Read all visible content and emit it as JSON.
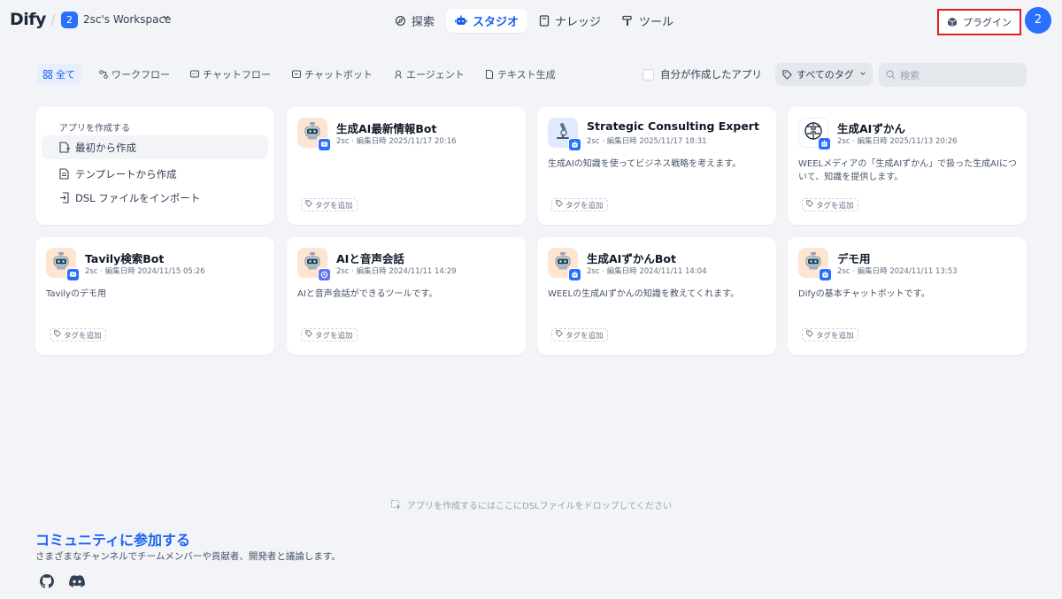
{
  "header": {
    "logo": "Dify",
    "workspace_badge": "2",
    "workspace_name": "2sc's Workspace",
    "nav": [
      {
        "label": "探索",
        "icon": "explore-icon"
      },
      {
        "label": "スタジオ",
        "icon": "robot-icon",
        "active": true
      },
      {
        "label": "ナレッジ",
        "icon": "book-icon"
      },
      {
        "label": "ツール",
        "icon": "hammer-icon"
      }
    ],
    "plugin_label": "プラグイン",
    "avatar_label": "2",
    "highlight_color": "#e11d1d"
  },
  "filters": {
    "tabs": [
      "全て",
      "ワークフロー",
      "チャットフロー",
      "チャットボット",
      "エージェント",
      "テキスト生成"
    ],
    "active_tab": "全て",
    "mine_label": "自分が作成したアプリ",
    "tag_select": "すべてのタグ",
    "search_placeholder": "検索"
  },
  "create": {
    "title": "アプリを作成する",
    "items": [
      "最初から作成",
      "テンプレートから作成",
      "DSL ファイルをインポート"
    ]
  },
  "apps": [
    {
      "name": "生成AI最新情報Bot",
      "author": "2sc",
      "edited": "編集日時 2025/11/17 20:16",
      "desc": "",
      "icon": "robot-icon"
    },
    {
      "name": "Strategic Consulting Expert",
      "author": "2sc",
      "edited": "編集日時 2025/11/17 18:31",
      "desc": "生成AIの知識を使ってビジネス戦略を考えます。",
      "icon": "microscope-icon"
    },
    {
      "name": "生成AIずかん",
      "author": "2sc",
      "edited": "編集日時 2025/11/13 20:26",
      "desc": "WEELメディアの「生成AIずかん」で扱った生成AIについて、知識を提供します。",
      "icon": "brain-chip-icon"
    },
    {
      "name": "Tavily検索Bot",
      "author": "2sc",
      "edited": "編集日時 2024/11/15 05:26",
      "desc": "Tavilyのデモ用",
      "icon": "robot-icon"
    },
    {
      "name": "AIと音声会話",
      "author": "2sc",
      "edited": "編集日時 2024/11/11 14:29",
      "desc": "AIと音声会話ができるツールです。",
      "icon": "robot-icon"
    },
    {
      "name": "生成AIずかんBot",
      "author": "2sc",
      "edited": "編集日時 2024/11/11 14:04",
      "desc": "WEELの生成AIずかんの知識を教えてくれます。",
      "icon": "robot-icon"
    },
    {
      "name": "デモ用",
      "author": "2sc",
      "edited": "編集日時 2024/11/11 13:53",
      "desc": "Difyの基本チャットボットです。",
      "icon": "robot-icon"
    }
  ],
  "tag_add_label": "タグを追加",
  "footer": {
    "drop_hint": "アプリを作成するにはここにDSLファイルをドロップしてください",
    "community_title": "コミュニティに参加する",
    "community_sub": "さまざまなチャンネルでチームメンバーや貢献者、開発者と議論します。",
    "social": [
      "github-icon",
      "discord-icon"
    ]
  }
}
